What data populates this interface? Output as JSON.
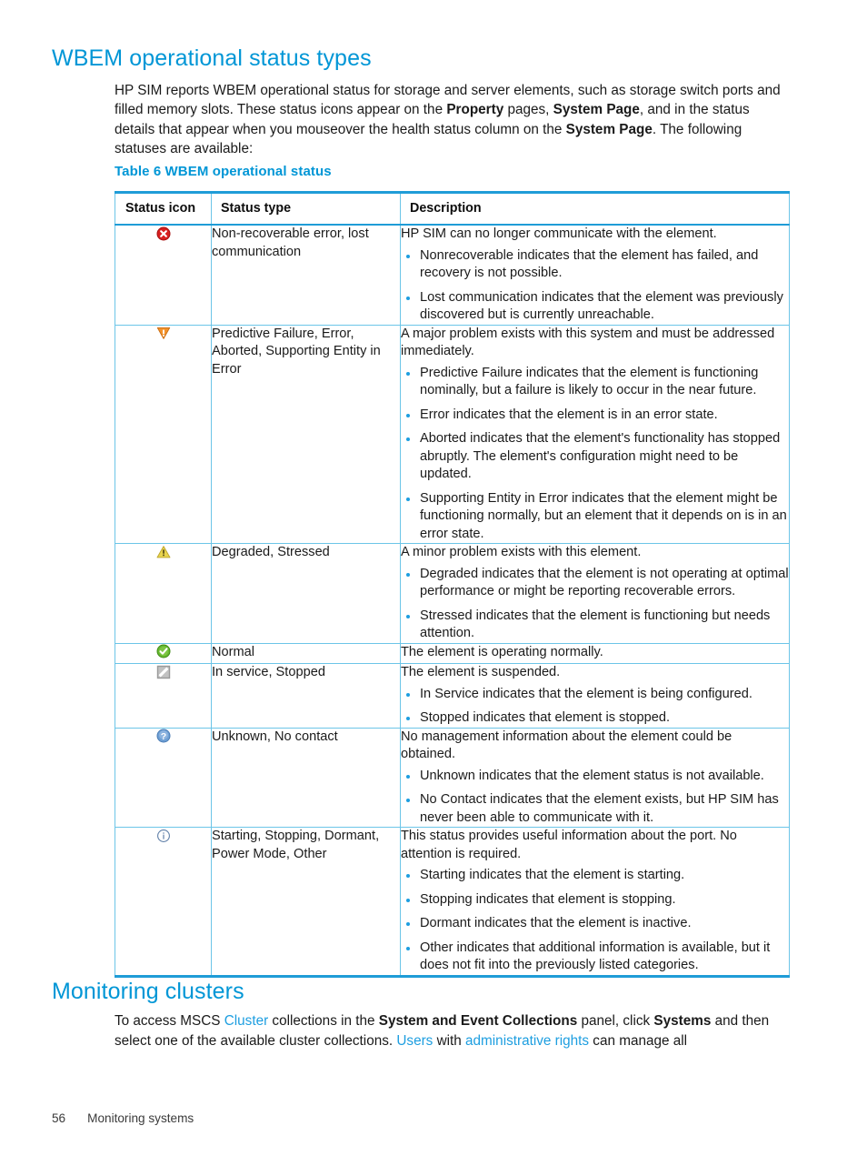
{
  "document": {
    "heading_1": "WBEM operational status types",
    "intro_segments": [
      {
        "text": "HP SIM reports WBEM operational status for storage and server elements, such as storage switch ports and filled memory slots. These status icons appear on the ",
        "style": "normal"
      },
      {
        "text": "Property",
        "style": "bold"
      },
      {
        "text": " pages, ",
        "style": "normal"
      },
      {
        "text": "System Page",
        "style": "bold"
      },
      {
        "text": ", and in the status details that appear when you mouseover the health status column on the ",
        "style": "normal"
      },
      {
        "text": "System Page",
        "style": "bold"
      },
      {
        "text": ". The following statuses are available:",
        "style": "normal"
      }
    ],
    "table_caption": "Table 6 WBEM operational status",
    "heading_2": "Monitoring clusters",
    "cluster_segments": [
      {
        "text": "To access MSCS ",
        "style": "normal"
      },
      {
        "text": "Cluster",
        "style": "link"
      },
      {
        "text": " collections in the ",
        "style": "normal"
      },
      {
        "text": "System and Event Collections",
        "style": "bold"
      },
      {
        "text": " panel, click ",
        "style": "normal"
      },
      {
        "text": "Systems",
        "style": "bold"
      },
      {
        "text": " and then select one of the available cluster collections. ",
        "style": "normal"
      },
      {
        "text": "Users",
        "style": "link"
      },
      {
        "text": " with ",
        "style": "normal"
      },
      {
        "text": "administrative rights",
        "style": "link"
      },
      {
        "text": " can manage all",
        "style": "normal"
      }
    ]
  },
  "footer": {
    "page_number": "56",
    "chapter": "Monitoring systems"
  },
  "table": {
    "headers": [
      "Status icon",
      "Status type",
      "Description"
    ],
    "rows": [
      {
        "icon": "error-circle-red-icon",
        "status_type": "Non-recoverable error, lost communication",
        "lead": "HP SIM can no longer communicate with the element.",
        "bullets": [
          "Nonrecoverable indicates that the element has failed, and recovery is not possible.",
          "Lost communication indicates that the element was previously discovered but is currently unreachable."
        ]
      },
      {
        "icon": "major-warning-triangle-orange-icon",
        "status_type": "Predictive Failure, Error, Aborted, Supporting Entity in Error",
        "lead": "A major problem exists with this system and must be addressed immediately.",
        "bullets": [
          "Predictive Failure indicates that the element is functioning nominally, but a failure is likely to occur in the near future.",
          "Error indicates that the element is in an error state.",
          "Aborted indicates that the element's functionality has stopped abruptly. The element's configuration might need to be updated.",
          "Supporting Entity in Error indicates that the element might be functioning normally, but an element that it depends on is in an error state."
        ]
      },
      {
        "icon": "minor-warning-triangle-yellow-icon",
        "status_type": "Degraded, Stressed",
        "lead": "A minor problem exists with this element.",
        "bullets": [
          "Degraded indicates that the element is not operating at optimal performance or might be reporting recoverable errors.",
          "Stressed indicates that the element is functioning but needs attention."
        ]
      },
      {
        "icon": "normal-check-circle-green-icon",
        "status_type": "Normal",
        "lead": "The element is operating normally.",
        "bullets": []
      },
      {
        "icon": "suspended-gray-square-icon",
        "status_type": "In service, Stopped",
        "lead": "The element is suspended.",
        "bullets": [
          "In Service indicates that the element is being configured.",
          "Stopped indicates that element is stopped."
        ]
      },
      {
        "icon": "unknown-question-circle-blue-icon",
        "status_type": "Unknown, No contact",
        "lead": "No management information about the element could be obtained.",
        "bullets": [
          "Unknown indicates that the element status is not available.",
          "No Contact indicates that the element exists, but HP SIM has never been able to communicate with it."
        ]
      },
      {
        "icon": "informational-circle-icon",
        "status_type": "Starting, Stopping, Dormant, Power Mode, Other",
        "lead": "This status provides useful information about the port. No attention is required.",
        "bullets": [
          "Starting indicates that the element is starting.",
          "Stopping indicates that element is stopping.",
          "Dormant indicates that the element is inactive.",
          "Other indicates that additional information is available, but it does not fit into the previously listed categories."
        ]
      }
    ]
  },
  "colors": {
    "heading_blue": "#0096d6",
    "link_blue": "#1d9ee0",
    "table_border_blue": "#6cc5e8",
    "table_rule_blue": "#1f9cd7",
    "bullet_blue": "#1d9ee0",
    "error_red": "#d81f1f",
    "major_orange": "#f3922b",
    "minor_yellow": "#e8d44d",
    "normal_green": "#67b92e",
    "suspended_gray": "#9a9a9a",
    "unknown_blue": "#6e9fd4",
    "info_blue": "#5f7fa8"
  }
}
